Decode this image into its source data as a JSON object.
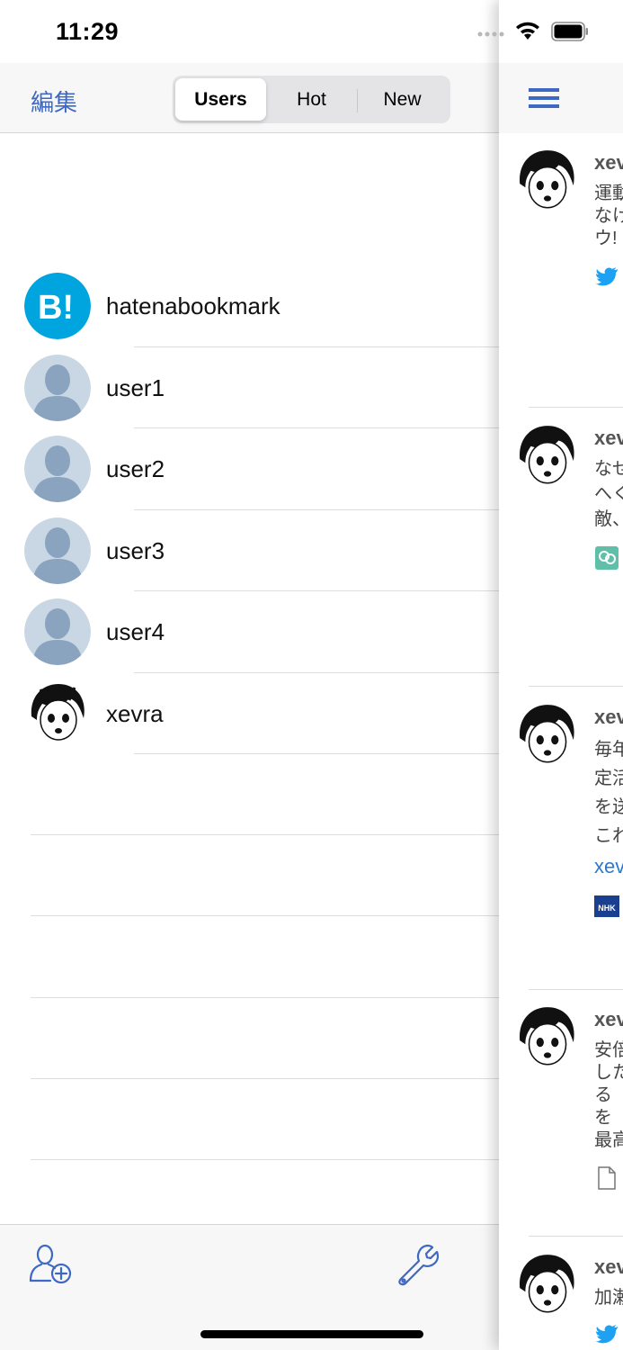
{
  "status_bar": {
    "time": "11:29"
  },
  "nav": {
    "edit_label": "編集"
  },
  "segments": [
    {
      "label": "Users",
      "active": true
    },
    {
      "label": "Hot",
      "active": false
    },
    {
      "label": "New",
      "active": false
    }
  ],
  "users": [
    {
      "name": "hatenabookmark",
      "avatar": "hatena-b-logo"
    },
    {
      "name": "user1",
      "avatar": "placeholder-person"
    },
    {
      "name": "user2",
      "avatar": "placeholder-person"
    },
    {
      "name": "user3",
      "avatar": "placeholder-person"
    },
    {
      "name": "user4",
      "avatar": "placeholder-person"
    },
    {
      "name": "xevra",
      "avatar": "manga-portrait"
    }
  ],
  "toolbar": {
    "left_icon": "add-user-icon",
    "right_icon": "wrench-icon"
  },
  "right_pane": {
    "menu_icon": "hamburger-menu-icon",
    "feed": [
      {
        "name": "xev",
        "lines": [
          "運動",
          "なけ",
          "ウ!"
        ],
        "source_icon": "twitter-bird-icon"
      },
      {
        "name": "xev",
        "lines": [
          "なせ",
          "へく",
          "敵、"
        ],
        "source_icon": "teal-badge-icon"
      },
      {
        "name": "xev",
        "lines": [
          "毎年",
          "定活",
          "を送",
          "これ"
        ],
        "link": "xev",
        "source_icon": "nhk-logo-icon"
      },
      {
        "name": "xev",
        "lines": [
          "安倍",
          "した",
          "る",
          "を",
          "最高"
        ],
        "source_icon": "document-icon"
      },
      {
        "name": "xev",
        "lines": [
          "加瀬"
        ],
        "source_icon": "twitter-bird-icon"
      }
    ]
  },
  "colors": {
    "accent": "#3d69c4",
    "hatena_blue": "#00a4de",
    "placeholder_avatar_bg": "#c9d6e3",
    "placeholder_avatar_fg": "#8aa4bf",
    "twitter_blue": "#1da1f2",
    "link_blue": "#2b7ad1"
  }
}
